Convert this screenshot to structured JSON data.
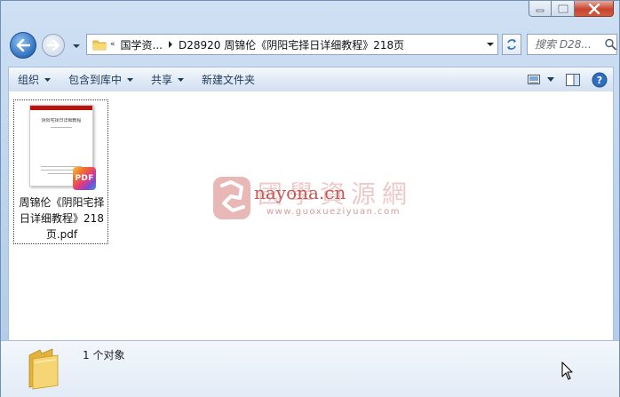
{
  "window": {
    "controls": {
      "minimize": "minimize-icon",
      "maximize": "maximize-icon",
      "close": "close-icon"
    }
  },
  "nav": {
    "address": {
      "overflow": "«",
      "crumbs": [
        "国学资...",
        "D28920 周锦伦《阴阳宅择日详细教程》218页"
      ]
    },
    "search_placeholder": "搜索 D28..."
  },
  "toolbar": {
    "items": [
      {
        "label": "组织",
        "has_dropdown": true
      },
      {
        "label": "包含到库中",
        "has_dropdown": true
      },
      {
        "label": "共享",
        "has_dropdown": true
      },
      {
        "label": "新建文件夹",
        "has_dropdown": false
      }
    ]
  },
  "content": {
    "files": [
      {
        "name": "周锦伦《阴阳宅择日详细教程》218页.pdf",
        "type": "pdf",
        "badge": "PDF",
        "thumb_title": "阴阳宅择日详细教程"
      }
    ]
  },
  "watermark": {
    "cn": "國學資源網",
    "site": "nayona.cn",
    "sub": "www.guoxueziyuan.com"
  },
  "details": {
    "count_text": "1 个对象"
  },
  "colors": {
    "chrome": "#b9d1ec",
    "toolbar_text": "#1e395b",
    "pdf_red": "#b8140f"
  }
}
